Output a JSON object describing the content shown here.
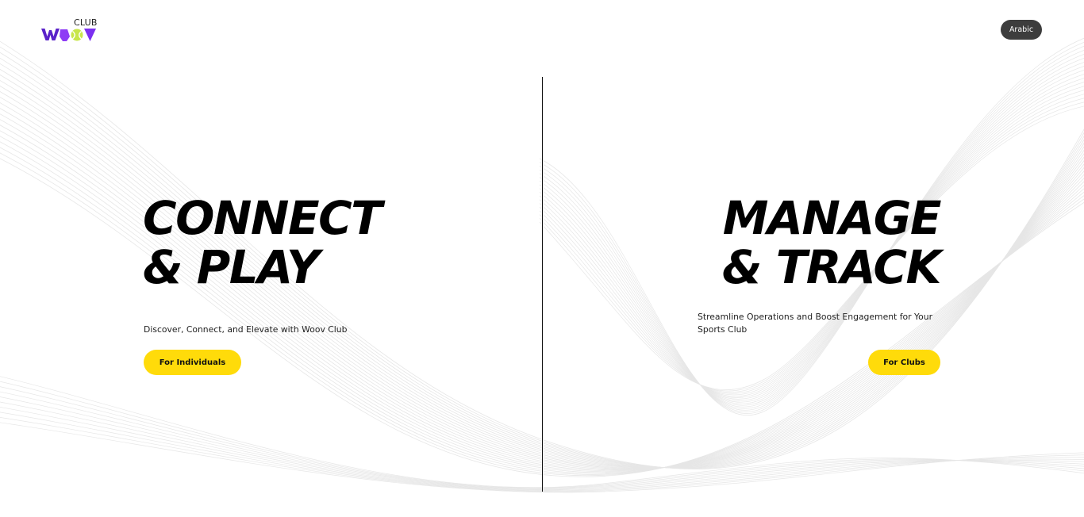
{
  "header": {
    "logo": {
      "sub_label": "CLUB",
      "wordmark": "WOOV",
      "colors": {
        "primary": "#7b2ff0",
        "dark": "#4b1fb0",
        "ball": "#c8e64a"
      }
    },
    "language_button_label": "Arabic"
  },
  "left_panel": {
    "title_line1": "CONNECT",
    "title_line2": "& PLAY",
    "description": "Discover, Connect, and Elevate with Woov Club",
    "button_label": "For Individuals"
  },
  "right_panel": {
    "title_line1": "MANAGE",
    "title_line2": "& TRACK",
    "description": "Streamline Operations and Boost Engagement for Your Sports Club",
    "button_label": "For Clubs"
  },
  "colors": {
    "accent": "#ffdb0a",
    "text": "#000000",
    "lang_button_bg": "#3d3d3d",
    "wave_lines": "#e6e6e6"
  }
}
